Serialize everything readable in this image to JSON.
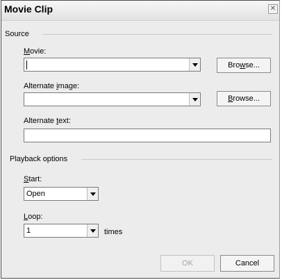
{
  "dialog": {
    "title": "Movie Clip",
    "close_glyph": "✕"
  },
  "source": {
    "section_label": "Source",
    "movie": {
      "label_prefix": "",
      "label_mnemonic": "M",
      "label_suffix": "ovie:",
      "value": ""
    },
    "alternate_image": {
      "label_prefix": "Alternate ",
      "label_mnemonic": "i",
      "label_suffix": "mage:",
      "value": ""
    },
    "alternate_text": {
      "label_prefix": "Alternate ",
      "label_mnemonic": "t",
      "label_suffix": "ext:",
      "value": ""
    },
    "browse_movie": {
      "prefix": "Bro",
      "mnemonic": "w",
      "suffix": "se..."
    },
    "browse_image": {
      "prefix": "",
      "mnemonic": "B",
      "suffix": "rowse..."
    }
  },
  "playback": {
    "section_label": "Playback options",
    "start": {
      "label_prefix": "",
      "label_mnemonic": "S",
      "label_suffix": "tart:",
      "value": "Open"
    },
    "loop": {
      "label_prefix": "",
      "label_mnemonic": "L",
      "label_suffix": "oop:",
      "value": "1",
      "suffix_text": "times"
    }
  },
  "footer": {
    "ok_label": "OK",
    "cancel_label": "Cancel"
  }
}
